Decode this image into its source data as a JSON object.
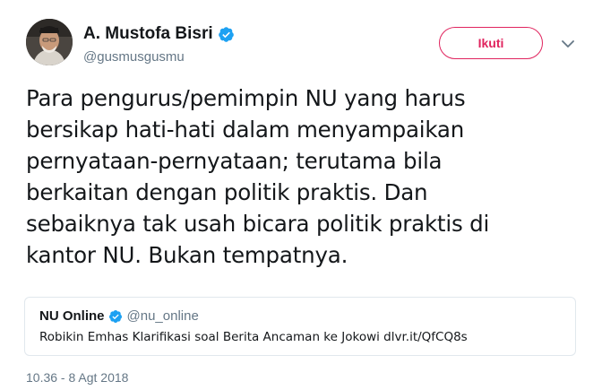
{
  "author": {
    "name": "A. Mustofa Bisri",
    "handle": "@gusmusgusmu",
    "verified": true,
    "verified_icon": "verified-badge-icon",
    "avatar_icon": "profile-photo"
  },
  "follow_button": {
    "label": "Ikuti",
    "color": "#e0245e"
  },
  "menu_icon": "chevron-down-icon",
  "tweet": {
    "lines": [
      "Para pengurus/pemimpin NU yang harus",
      "bersikap hati-hati dalam menyampaikan",
      "pernyataan-pernyataan; terutama bila",
      "berkaitan dengan politik praktis. Dan",
      "sebaiknya tak usah bicara politik praktis di",
      "kantor NU. Bukan tempatnya."
    ]
  },
  "quoted_tweet": {
    "name": "NU Online",
    "handle": "@nu_online",
    "verified": true,
    "text": "Robikin Emhas Klarifikasi soal Berita Ancaman ke Jokowi dlvr.it/QfCQ8s"
  },
  "timestamp": "10.36 - 8 Agt 2018",
  "colors": {
    "verified_blue": "#1da1f2",
    "secondary_text": "#657786",
    "border": "#e1e8ed"
  }
}
